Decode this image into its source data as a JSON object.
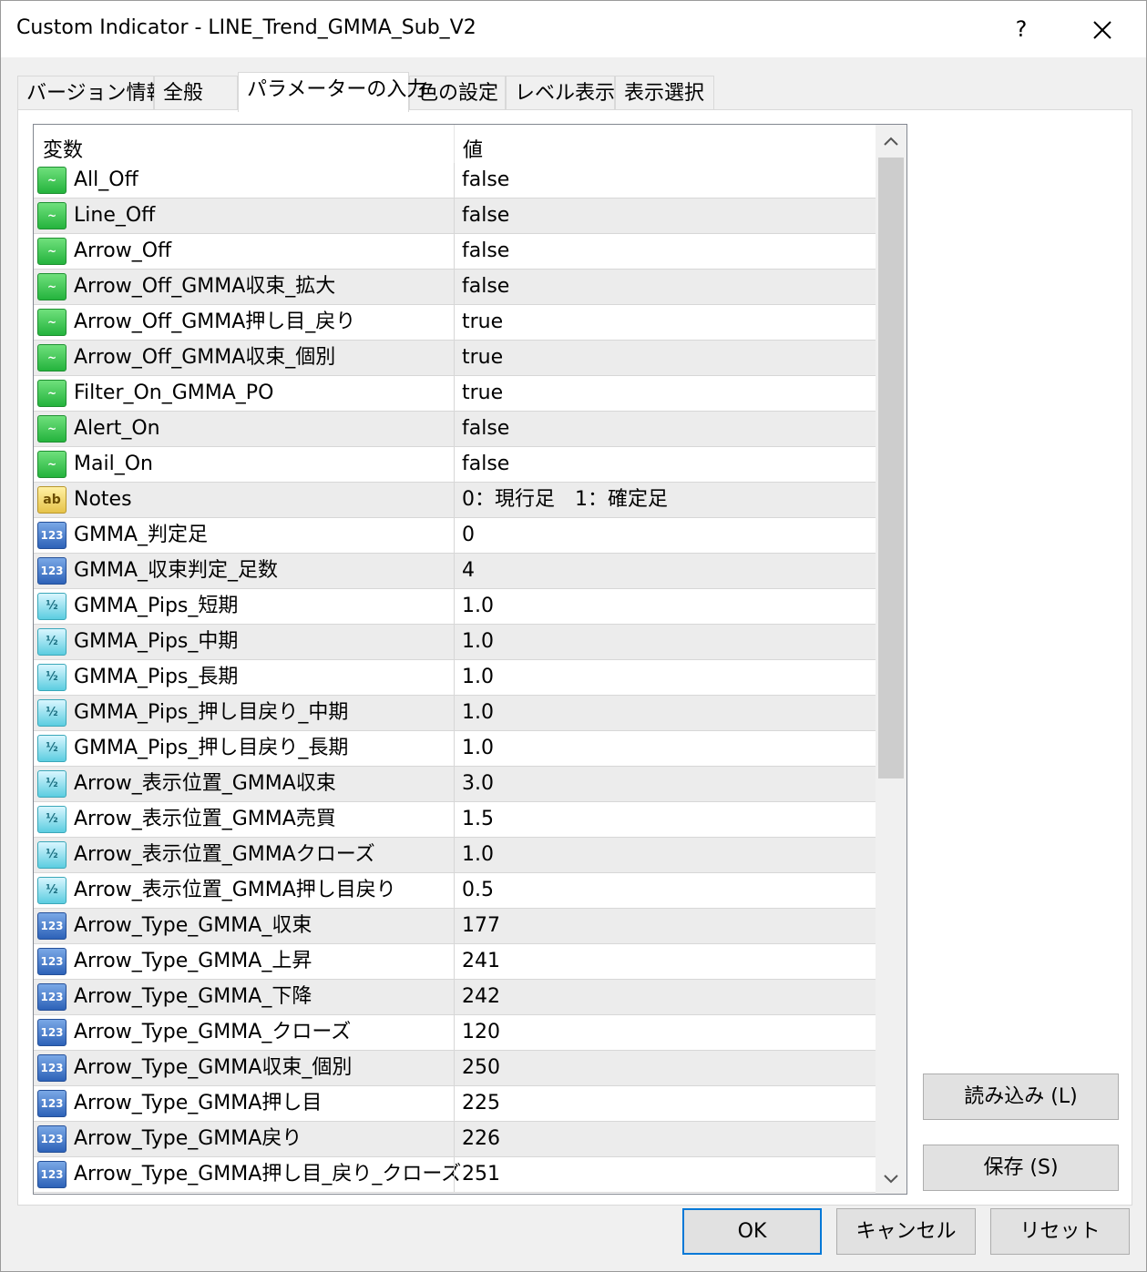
{
  "window": {
    "title": "Custom Indicator - LINE_Trend_GMMA_Sub_V2",
    "help_label": "?",
    "close_icon": "close-icon"
  },
  "tabs": [
    {
      "label": "バージョン情報"
    },
    {
      "label": "全般"
    },
    {
      "label": "パラメーターの入力",
      "active": true
    },
    {
      "label": "色の設定"
    },
    {
      "label": "レベル表示"
    },
    {
      "label": "表示選択"
    }
  ],
  "grid": {
    "headers": {
      "variable": "変数",
      "value": "値"
    },
    "rows": [
      {
        "type": "bool",
        "name": "All_Off",
        "value": "false"
      },
      {
        "type": "bool",
        "name": "Line_Off",
        "value": "false"
      },
      {
        "type": "bool",
        "name": "Arrow_Off",
        "value": "false"
      },
      {
        "type": "bool",
        "name": "Arrow_Off_GMMA収束_拡大",
        "value": "false"
      },
      {
        "type": "bool",
        "name": "Arrow_Off_GMMA押し目_戻り",
        "value": "true"
      },
      {
        "type": "bool",
        "name": "Arrow_Off_GMMA収束_個別",
        "value": "true"
      },
      {
        "type": "bool",
        "name": "Filter_On_GMMA_PO",
        "value": "true"
      },
      {
        "type": "bool",
        "name": "Alert_On",
        "value": "false"
      },
      {
        "type": "bool",
        "name": "Mail_On",
        "value": "false"
      },
      {
        "type": "string",
        "name": "Notes",
        "value": "0：現行足　1：確定足"
      },
      {
        "type": "int",
        "name": "GMMA_判定足",
        "value": "0"
      },
      {
        "type": "int",
        "name": "GMMA_収束判定_足数",
        "value": "4"
      },
      {
        "type": "double",
        "name": "GMMA_Pips_短期",
        "value": "1.0"
      },
      {
        "type": "double",
        "name": "GMMA_Pips_中期",
        "value": "1.0"
      },
      {
        "type": "double",
        "name": "GMMA_Pips_長期",
        "value": "1.0"
      },
      {
        "type": "double",
        "name": "GMMA_Pips_押し目戻り_中期",
        "value": "1.0"
      },
      {
        "type": "double",
        "name": "GMMA_Pips_押し目戻り_長期",
        "value": "1.0"
      },
      {
        "type": "double",
        "name": "Arrow_表示位置_GMMA収束",
        "value": "3.0"
      },
      {
        "type": "double",
        "name": "Arrow_表示位置_GMMA売買",
        "value": "1.5"
      },
      {
        "type": "double",
        "name": "Arrow_表示位置_GMMAクローズ",
        "value": "1.0"
      },
      {
        "type": "double",
        "name": "Arrow_表示位置_GMMA押し目戻り",
        "value": "0.5"
      },
      {
        "type": "int",
        "name": "Arrow_Type_GMMA_収束",
        "value": "177"
      },
      {
        "type": "int",
        "name": "Arrow_Type_GMMA_上昇",
        "value": "241"
      },
      {
        "type": "int",
        "name": "Arrow_Type_GMMA_下降",
        "value": "242"
      },
      {
        "type": "int",
        "name": "Arrow_Type_GMMA_クローズ",
        "value": "120"
      },
      {
        "type": "int",
        "name": "Arrow_Type_GMMA収束_個別",
        "value": "250"
      },
      {
        "type": "int",
        "name": "Arrow_Type_GMMA押し目",
        "value": "225"
      },
      {
        "type": "int",
        "name": "Arrow_Type_GMMA戻り",
        "value": "226"
      },
      {
        "type": "int",
        "name": "Arrow_Type_GMMA押し目_戻り_クローズ",
        "value": "251"
      }
    ],
    "icon_glyphs": {
      "bool": "~",
      "string": "ab",
      "int": "123",
      "double": "½"
    }
  },
  "side_buttons": {
    "load": "読み込み (L)",
    "save": "保存 (S)"
  },
  "footer_buttons": {
    "ok": "OK",
    "cancel": "キャンセル",
    "reset": "リセット"
  }
}
